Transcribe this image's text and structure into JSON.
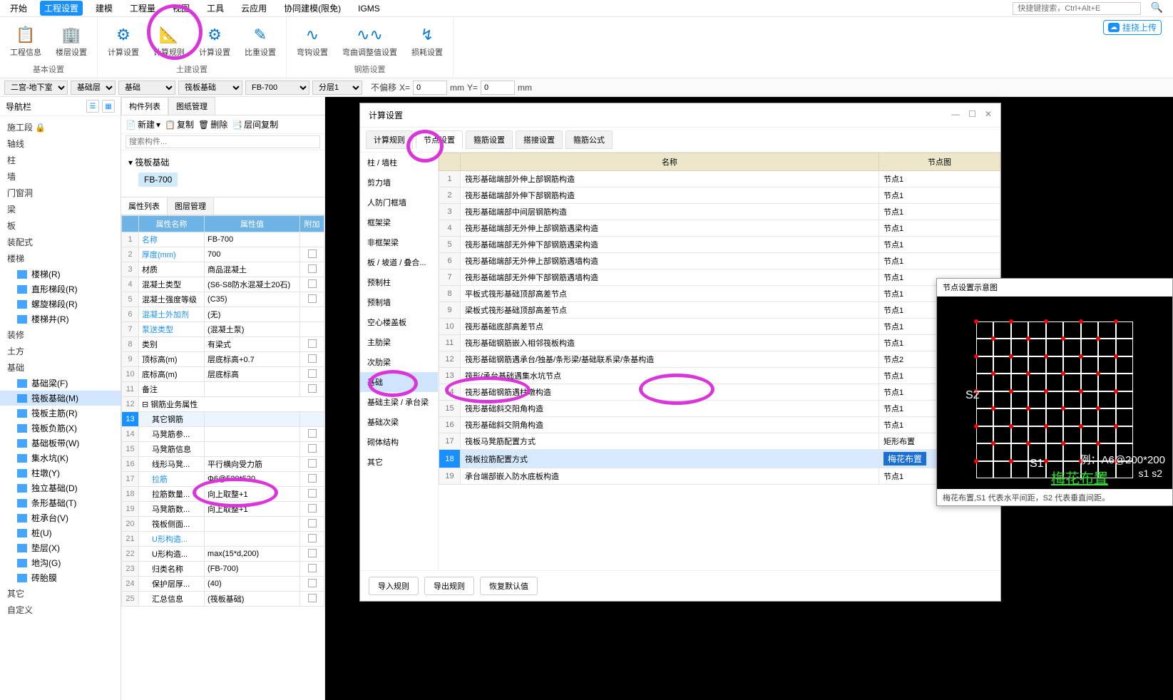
{
  "menu": {
    "items": [
      "开始",
      "工程设置",
      "建模",
      "工程量",
      "视图",
      "工具",
      "云应用",
      "协同建模(限免)",
      "IGMS"
    ],
    "active": 1,
    "search_ph": "快捷键搜索，Ctrl+Alt+E",
    "upload": "挂挠上传"
  },
  "ribbon": {
    "groups": [
      {
        "name": "基本设置",
        "btns": [
          {
            "t": "工程信息",
            "i": "📋"
          },
          {
            "t": "楼层设置",
            "i": "🏢"
          }
        ]
      },
      {
        "name": "土建设置",
        "btns": [
          {
            "t": "计算设置",
            "i": "⚙"
          },
          {
            "t": "计算规则",
            "i": "📐"
          },
          {
            "t": "计算设置",
            "i": "⚙"
          },
          {
            "t": "比重设置",
            "i": "✎"
          }
        ]
      },
      {
        "name": "钢筋设置",
        "btns": [
          {
            "t": "弯钩设置",
            "i": "∿"
          },
          {
            "t": "弯曲调整值设置",
            "i": "∿∿"
          },
          {
            "t": "损耗设置",
            "i": "↯"
          }
        ]
      }
    ]
  },
  "filters": {
    "floor": "二宫-地下室",
    "layer": "基础层",
    "cat": "基础",
    "type": "筏板基础",
    "comp": "FB-700",
    "split": "分层1",
    "offset": "不偏移",
    "x": "0",
    "y": "0",
    "unit": "mm"
  },
  "nav": {
    "title": "导航栏",
    "items": [
      "施工段 🔒",
      "轴线",
      "柱",
      "墙",
      "门窗洞",
      "梁",
      "板",
      "装配式",
      "楼梯"
    ],
    "stair_sub": [
      {
        "t": "楼梯(R)",
        "i": "#1890ff"
      },
      {
        "t": "直形梯段(R)",
        "i": "#1890ff"
      },
      {
        "t": "螺旋梯段(R)",
        "i": "#1890ff"
      },
      {
        "t": "楼梯井(R)",
        "i": "#1890ff"
      }
    ],
    "after": [
      "装修",
      "土方",
      "基础"
    ],
    "found_sub": [
      "基础梁(F)",
      "筏板基础(M)",
      "筏板主筋(R)",
      "筏板负筋(X)",
      "基础板带(W)",
      "集水坑(K)",
      "柱墩(Y)",
      "独立基础(D)",
      "条形基础(T)",
      "桩承台(V)",
      "桩(U)",
      "垫层(X)",
      "地沟(G)",
      "砖胎膜"
    ],
    "found_sel": 1,
    "tail": [
      "其它",
      "自定义"
    ]
  },
  "complist": {
    "tabs": [
      "构件列表",
      "图纸管理"
    ],
    "tactive": 0,
    "tb": [
      "新建",
      "复制",
      "删除",
      "层间复制"
    ],
    "search_ph": "搜索构件...",
    "root": "筏板基础",
    "leaf": "FB-700"
  },
  "prop": {
    "tabs": [
      "属性列表",
      "图层管理"
    ],
    "tactive": 0,
    "cols": [
      "属性名称",
      "属性值",
      "附加"
    ],
    "rows": [
      {
        "n": 1,
        "k": "名称",
        "v": "FB-700",
        "blue": true
      },
      {
        "n": 2,
        "k": "厚度(mm)",
        "v": "700",
        "blue": true,
        "chk": true
      },
      {
        "n": 3,
        "k": "材质",
        "v": "商品混凝土",
        "chk": true
      },
      {
        "n": 4,
        "k": "混凝土类型",
        "v": "(S6-S8防水混凝土20石)",
        "chk": true
      },
      {
        "n": 5,
        "k": "混凝土强度等级",
        "v": "(C35)",
        "chk": true
      },
      {
        "n": 6,
        "k": "混凝土外加剂",
        "v": "(无)",
        "blue": true
      },
      {
        "n": 7,
        "k": "泵送类型",
        "v": "(混凝土泵)",
        "blue": true
      },
      {
        "n": 8,
        "k": "类别",
        "v": "有梁式",
        "chk": true
      },
      {
        "n": 9,
        "k": "顶标高(m)",
        "v": "层底标高+0.7",
        "chk": true
      },
      {
        "n": 10,
        "k": "底标高(m)",
        "v": "层底标高",
        "chk": true
      },
      {
        "n": 11,
        "k": "备注",
        "v": "",
        "chk": true
      },
      {
        "n": 12,
        "k": "⊟ 钢筋业务属性",
        "v": "",
        "span": true
      },
      {
        "n": 13,
        "k": "其它钢筋",
        "v": "",
        "hl": true
      },
      {
        "n": 14,
        "k": "马凳筋参...",
        "v": "",
        "chk": true
      },
      {
        "n": 15,
        "k": "马凳筋信息",
        "v": "",
        "chk": true
      },
      {
        "n": 16,
        "k": "线形马凳...",
        "v": "平行横向受力筋",
        "chk": true
      },
      {
        "n": 17,
        "k": "拉筋",
        "v": "Φ6@520*520",
        "blue": true,
        "chk": true
      },
      {
        "n": 18,
        "k": "拉筋数量...",
        "v": "向上取整+1",
        "chk": true
      },
      {
        "n": 19,
        "k": "马凳筋数...",
        "v": "向上取整+1",
        "chk": true
      },
      {
        "n": 20,
        "k": "筏板侧面...",
        "v": "",
        "chk": true
      },
      {
        "n": 21,
        "k": "U形构造...",
        "v": "",
        "blue": true,
        "chk": true
      },
      {
        "n": 22,
        "k": "U形构造...",
        "v": "max(15*d,200)",
        "chk": true
      },
      {
        "n": 23,
        "k": "归类名称",
        "v": "(FB-700)",
        "chk": true
      },
      {
        "n": 24,
        "k": "保护层厚...",
        "v": "(40)",
        "chk": true
      },
      {
        "n": 25,
        "k": "汇总信息",
        "v": "(筏板基础)",
        "chk": true
      }
    ]
  },
  "dialog": {
    "title": "计算设置",
    "tabs": [
      "计算规则",
      "节点设置",
      "箍筋设置",
      "搭接设置",
      "箍筋公式"
    ],
    "tactive": 1,
    "side": [
      "柱 / 墙柱",
      "剪力墙",
      "人防门框墙",
      "框架梁",
      "非框架梁",
      "板 / 坡道 / 叠合...",
      "预制柱",
      "预制墙",
      "空心楼盖板",
      "主肋梁",
      "次肋梁",
      "基础",
      "基础主梁 / 承台梁",
      "基础次梁",
      "砌体结构",
      "其它"
    ],
    "side_sel": 11,
    "cols": [
      "名称",
      "节点图"
    ],
    "rows": [
      {
        "n": 1,
        "a": "筏形基础端部外伸上部钢筋构造",
        "b": "节点1"
      },
      {
        "n": 2,
        "a": "筏形基础端部外伸下部钢筋构造",
        "b": "节点1"
      },
      {
        "n": 3,
        "a": "筏形基础端部中间层钢筋构造",
        "b": "节点1"
      },
      {
        "n": 4,
        "a": "筏形基础端部无外伸上部钢筋遇梁构造",
        "b": "节点1"
      },
      {
        "n": 5,
        "a": "筏形基础端部无外伸下部钢筋遇梁构造",
        "b": "节点1"
      },
      {
        "n": 6,
        "a": "筏形基础端部无外伸上部钢筋遇墙构造",
        "b": "节点1"
      },
      {
        "n": 7,
        "a": "筏形基础端部无外伸下部钢筋遇墙构造",
        "b": "节点1"
      },
      {
        "n": 8,
        "a": "平板式筏形基础顶部高差节点",
        "b": "节点1"
      },
      {
        "n": 9,
        "a": "梁板式筏形基础顶部高差节点",
        "b": "节点1"
      },
      {
        "n": 10,
        "a": "筏形基础底部高差节点",
        "b": "节点1"
      },
      {
        "n": 11,
        "a": "筏形基础钢筋嵌入相邻筏板构造",
        "b": "节点1"
      },
      {
        "n": 12,
        "a": "筏形基础钢筋遇承台/独基/条形梁/基础联系梁/条基构造",
        "b": "节点2"
      },
      {
        "n": 13,
        "a": "筏形/承台基础遇集水坑节点",
        "b": "节点1"
      },
      {
        "n": 14,
        "a": "筏形基础钢筋遇柱墩构造",
        "b": "节点1"
      },
      {
        "n": 15,
        "a": "筏形基础斜交阳角构造",
        "b": "节点1"
      },
      {
        "n": 16,
        "a": "筏形基础斜交阴角构造",
        "b": "节点1"
      },
      {
        "n": 17,
        "a": "筏板马凳筋配置方式",
        "b": "矩形布置"
      },
      {
        "n": 18,
        "a": "筏板拉筋配置方式",
        "b": "梅花布置",
        "sel": true,
        "edit": true
      },
      {
        "n": 19,
        "a": "承台端部嵌入防水底板构造",
        "b": "节点1"
      }
    ],
    "btns": [
      "导入规则",
      "导出规则",
      "恢复默认值"
    ]
  },
  "diagram": {
    "title": "节点设置示意图",
    "s1": "S1",
    "s2": "S2",
    "eg": "例：A6@200*200",
    "eg2": "s1    s2",
    "cap": "梅花布置",
    "foot": "梅花布置,S1 代表水平间距，S2 代表垂直间距。"
  }
}
